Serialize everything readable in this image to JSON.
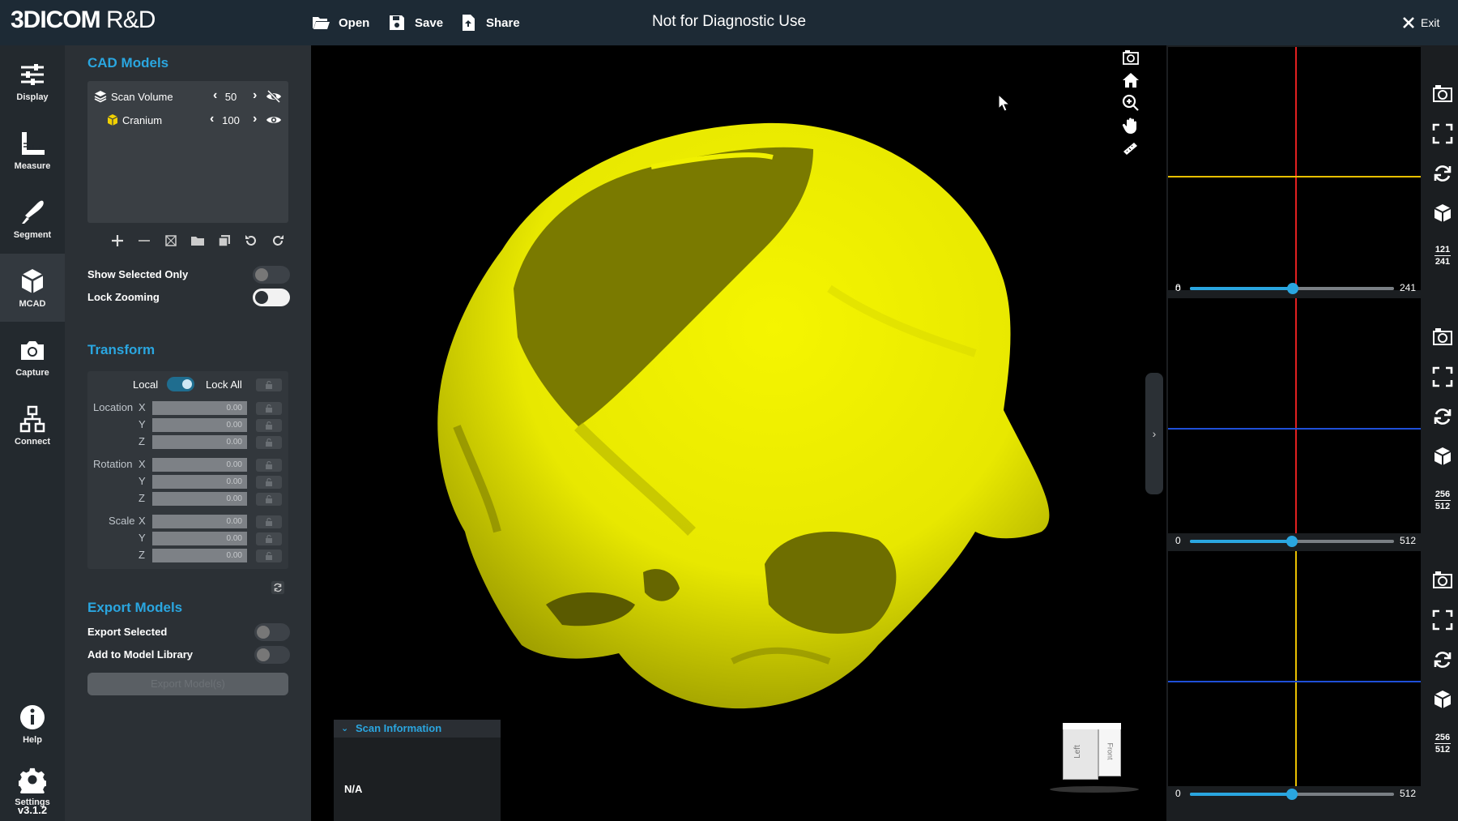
{
  "header": {
    "logo_bold": "3DICOM",
    "logo_rest": " R&D",
    "open_label": "Open",
    "save_label": "Save",
    "share_label": "Share",
    "banner": "Not for Diagnostic Use",
    "exit_label": "Exit"
  },
  "rail": {
    "items": [
      {
        "label": "Display",
        "icon": "sliders-icon"
      },
      {
        "label": "Measure",
        "icon": "ruler-icon"
      },
      {
        "label": "Segment",
        "icon": "scalpel-icon"
      },
      {
        "label": "MCAD",
        "icon": "cube-icon"
      },
      {
        "label": "Capture",
        "icon": "camera-icon"
      },
      {
        "label": "Connect",
        "icon": "network-icon"
      },
      {
        "label": "Help",
        "icon": "info-icon"
      },
      {
        "label": "Settings",
        "icon": "gear-icon"
      }
    ],
    "active": "MCAD",
    "version": "v3.1.2"
  },
  "cad": {
    "title": "CAD Models",
    "models": [
      {
        "name": "Scan Volume",
        "opacity": "50",
        "visible": false,
        "icon": "layers-icon"
      },
      {
        "name": "Cranium",
        "opacity": "100",
        "visible": true,
        "icon": "cube-icon"
      }
    ],
    "show_selected_only": {
      "label": "Show Selected Only",
      "on": false
    },
    "lock_zooming": {
      "label": "Lock Zooming",
      "on": true
    }
  },
  "transform": {
    "title": "Transform",
    "local_label": "Local",
    "lock_all_label": "Lock All",
    "location_label": "Location",
    "rotation_label": "Rotation",
    "scale_label": "Scale",
    "x": "X",
    "y": "Y",
    "z": "Z",
    "location": [
      "0.00",
      "0.00",
      "0.00"
    ],
    "rotation": [
      "0.00",
      "0.00",
      "0.00"
    ],
    "scale": [
      "0.00",
      "0.00",
      "0.00"
    ]
  },
  "export": {
    "title": "Export Models",
    "export_selected": {
      "label": "Export Selected",
      "on": false
    },
    "add_to_library": {
      "label": "Add to Model Library",
      "on": false
    },
    "button_label": "Export Model(s)"
  },
  "scan_info": {
    "title": "Scan Information",
    "value": "N/A"
  },
  "orientation_cube": {
    "left": "Left",
    "front": "Front"
  },
  "colors": {
    "accent": "#2aa6e0",
    "model": "#f0f000",
    "crosshair_red": "#e02020",
    "crosshair_yellow": "#e8c000",
    "crosshair_blue": "#1f4fd8"
  },
  "slices": [
    {
      "min": "0",
      "max": "241",
      "value": 121,
      "frac_num": "121",
      "frac_den": "241"
    },
    {
      "min": "0",
      "max": "512",
      "value": 256,
      "frac_num": "256",
      "frac_den": "512"
    },
    {
      "min": "0",
      "max": "512",
      "value": 256,
      "frac_num": "256",
      "frac_den": "512"
    }
  ]
}
